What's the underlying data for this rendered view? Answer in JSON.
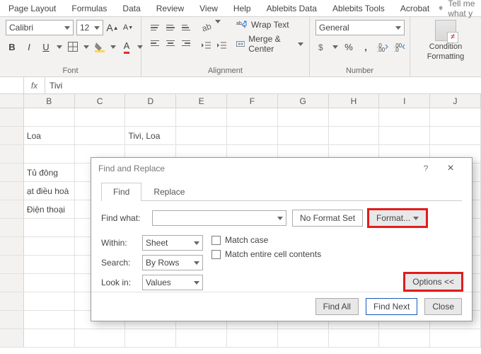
{
  "ribbonTabs": [
    "Page Layout",
    "Formulas",
    "Data",
    "Review",
    "View",
    "Help",
    "Ablebits Data",
    "Ablebits Tools",
    "Acrobat"
  ],
  "tellMe": "Tell me what y",
  "font": {
    "name": "Calibri",
    "size": "12",
    "bold": "B",
    "italic": "I",
    "underline": "U",
    "groupLabel": "Font"
  },
  "alignment": {
    "wrap": "Wrap Text",
    "merge": "Merge & Center",
    "groupLabel": "Alignment"
  },
  "number": {
    "format": "General",
    "groupLabel": "Number"
  },
  "cond": {
    "label1": "Condition",
    "label2": "Formatting"
  },
  "fx": {
    "label": "fx",
    "value": "Tivi"
  },
  "columns": [
    "B",
    "C",
    "D",
    "E",
    "F",
    "G",
    "H",
    "I",
    "J"
  ],
  "cells": {
    "b2": "Loa",
    "d2": "Tivi, Loa",
    "b4": "Tủ đông",
    "b5": "ạt điều hoà",
    "b6": "Điện thoại"
  },
  "dialog": {
    "title": "Find and Replace",
    "tabFind": "Find",
    "tabReplace": "Replace",
    "findWhatLabel": "Find what:",
    "noFormat": "No Format Set",
    "formatBtn": "Format...",
    "withinLabel": "Within:",
    "withinValue": "Sheet",
    "searchLabel": "Search:",
    "searchValue": "By Rows",
    "lookInLabel": "Look in:",
    "lookInValue": "Values",
    "matchCase": "Match case",
    "matchEntire": "Match entire cell contents",
    "optionsBtn": "Options <<",
    "findAll": "Find All",
    "findNext": "Find Next",
    "close": "Close"
  }
}
